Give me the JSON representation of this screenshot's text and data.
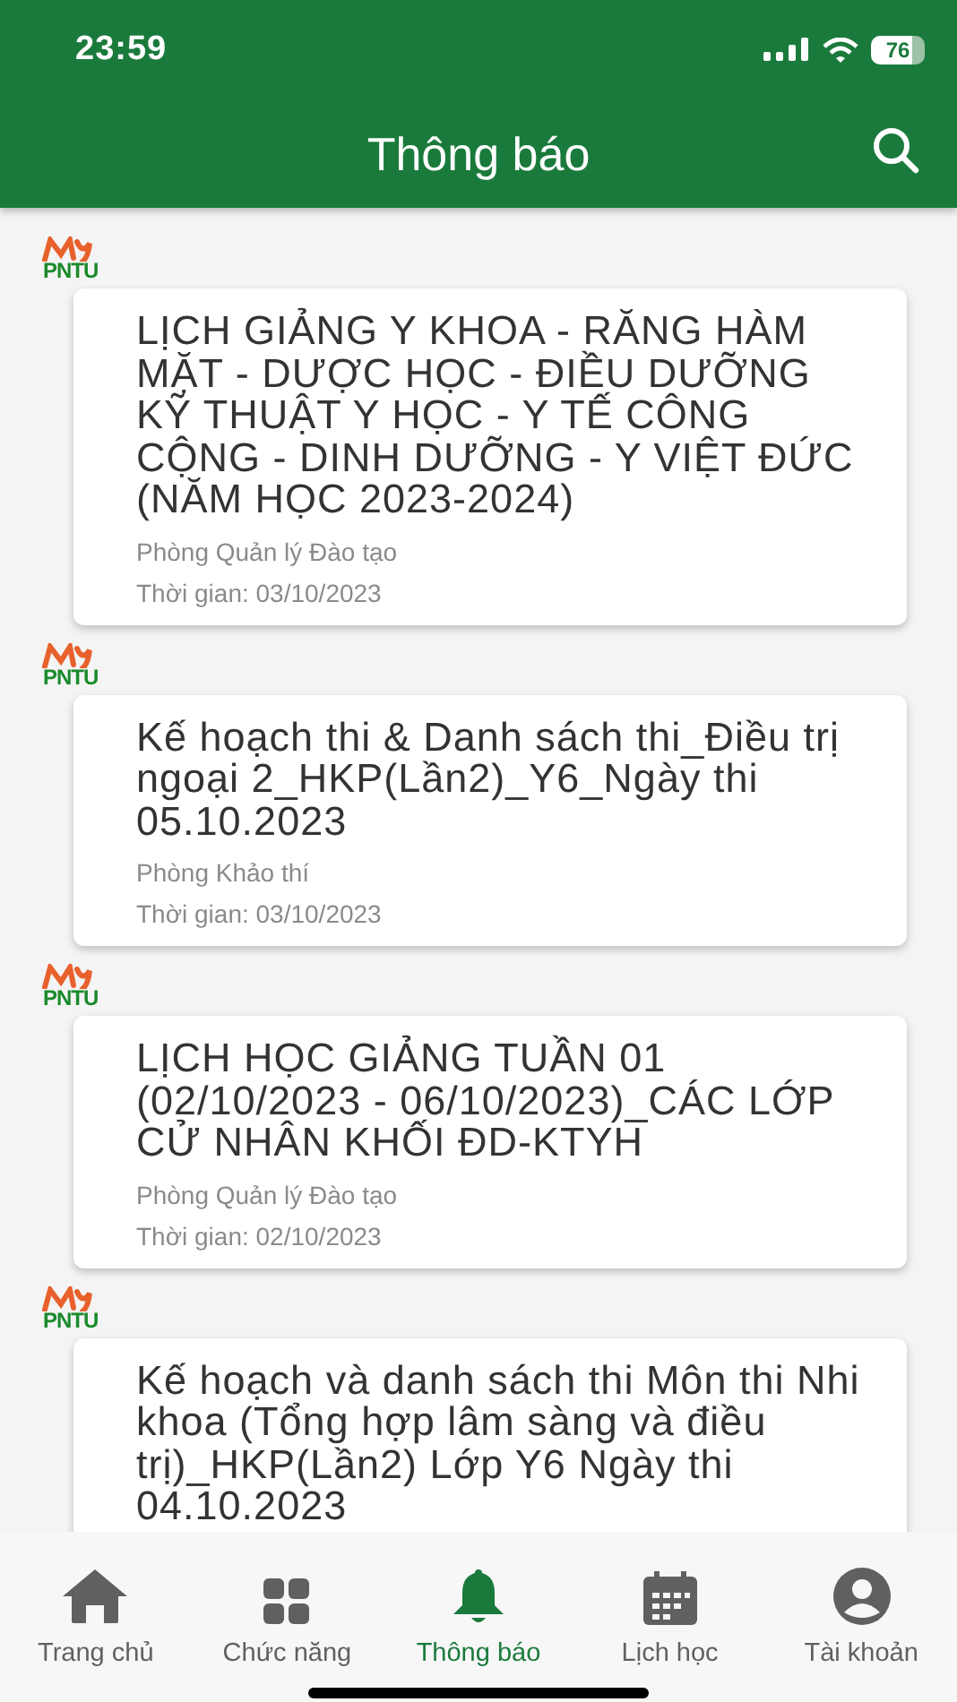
{
  "status_bar": {
    "time": "23:59",
    "battery": "76"
  },
  "header": {
    "title": "Thông báo"
  },
  "notices": [
    {
      "logo": "PNTU",
      "title": "LỊCH GIẢNG Y KHOA - RĂNG HÀM MẶT - DƯỢC HỌC - ĐIỀU DƯỠNG KỸ THUẬT Y HỌC - Y TẾ CÔNG CỘNG - DINH DƯỠNG - Y VIỆT ĐỨC (NĂM HỌC 2023-2024)",
      "department": "Phòng Quản lý Đào tạo",
      "time": "Thời gian: 03/10/2023"
    },
    {
      "logo": "PNTU",
      "title": "Kế hoạch thi & Danh sách thi_Điều trị ngoại 2_HKP(Lần2)_Y6_Ngày thi 05.10.2023",
      "department": "Phòng Khảo thí",
      "time": "Thời gian: 03/10/2023"
    },
    {
      "logo": "PNTU",
      "title": "LỊCH HỌC GIẢNG TUẦN 01 (02/10/2023 - 06/10/2023)_CÁC LỚP CỬ NHÂN KHỐI ĐD-KTYH",
      "department": "Phòng Quản lý Đào tạo",
      "time": "Thời gian: 02/10/2023"
    },
    {
      "logo": "PNTU",
      "title": "Kế hoạch và danh sách thi Môn thi Nhi khoa (Tổng hợp lâm sàng và điều trị)_HKP(Lần2) Lớp Y6 Ngày thi 04.10.2023"
    }
  ],
  "tabs": [
    {
      "kind": "home",
      "label": "Trang chủ",
      "selected": false
    },
    {
      "kind": "grid",
      "label": "Chức năng",
      "selected": false
    },
    {
      "kind": "bell",
      "label": "Thông báo",
      "selected": true
    },
    {
      "kind": "calendar",
      "label": "Lịch học",
      "selected": false
    },
    {
      "kind": "account",
      "label": "Tài khoản",
      "selected": false
    }
  ]
}
